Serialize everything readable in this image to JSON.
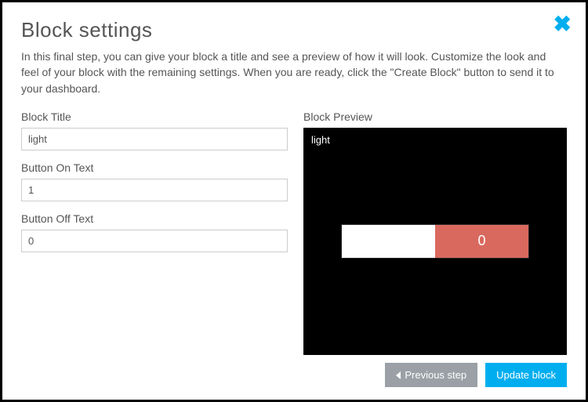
{
  "header": {
    "title": "Block settings",
    "description": "In this final step, you can give your block a title and see a preview of how it will look. Customize the look and feel of your block with the remaining settings. When you are ready, click the \"Create Block\" button to send it to your dashboard."
  },
  "form": {
    "block_title_label": "Block Title",
    "block_title_value": "light",
    "button_on_label": "Button On Text",
    "button_on_value": "1",
    "button_off_label": "Button Off Text",
    "button_off_value": "0"
  },
  "preview": {
    "label": "Block Preview",
    "title": "light",
    "off_text": "0"
  },
  "footer": {
    "previous_label": "Previous step",
    "update_label": "Update block"
  }
}
